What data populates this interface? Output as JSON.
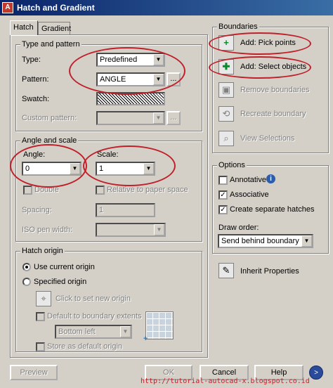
{
  "window": {
    "title": "Hatch and Gradient",
    "app_icon": "A"
  },
  "tabs": [
    {
      "label": "Hatch"
    },
    {
      "label": "Gradient"
    }
  ],
  "type_pattern": {
    "group_label": "Type and pattern",
    "type_label": "Type:",
    "type_value": "Predefined",
    "pattern_label": "Pattern:",
    "pattern_value": "ANGLE",
    "pattern_browse": "...",
    "swatch_label": "Swatch:",
    "custom_pattern_label": "Custom pattern:",
    "custom_browse": "..."
  },
  "angle_scale": {
    "group_label": "Angle and scale",
    "angle_label": "Angle:",
    "angle_value": "0",
    "scale_label": "Scale:",
    "scale_value": "1",
    "double_label": "Double",
    "relative_label": "Relative to paper space",
    "spacing_label": "Spacing:",
    "spacing_value": "1",
    "iso_label": "ISO pen width:"
  },
  "hatch_origin": {
    "group_label": "Hatch origin",
    "use_current_label": "Use current origin",
    "specified_label": "Specified origin",
    "click_set_label": "Click to set new origin",
    "default_boundary_label": "Default to boundary extents",
    "position_value": "Bottom left",
    "store_default_label": "Store as default origin"
  },
  "boundaries": {
    "group_label": "Boundaries",
    "add_pick_label": "Add: Pick points",
    "add_select_label": "Add: Select objects",
    "remove_label": "Remove boundaries",
    "recreate_label": "Recreate boundary",
    "view_label": "View Selections"
  },
  "options": {
    "group_label": "Options",
    "annotative_label": "Annotative",
    "associative_label": "Associative",
    "separate_label": "Create separate hatches",
    "draw_order_label": "Draw order:",
    "draw_order_value": "Send behind boundary"
  },
  "inherit_label": "Inherit Properties",
  "footer": {
    "preview": "Preview",
    "ok": "OK",
    "cancel": "Cancel",
    "help": "Help",
    "watermark": "http://tutorial-autocad-x.blogspot.co.id"
  },
  "colors": {
    "annotation": "#c0202a",
    "title_bar": "#0a246a",
    "dialog_bg": "#d4d0c8"
  }
}
